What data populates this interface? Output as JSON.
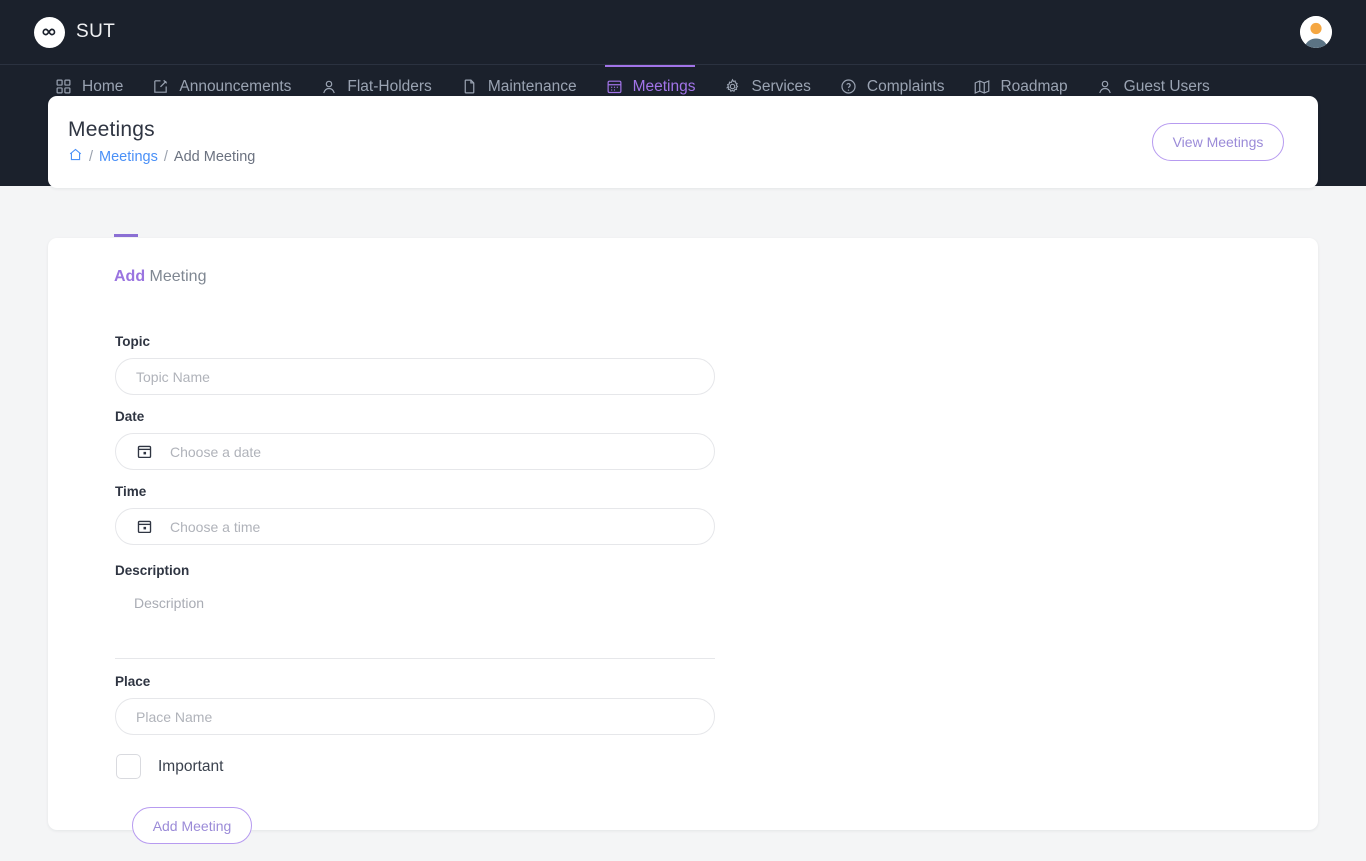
{
  "brand": {
    "logo_icon": "infinity-icon",
    "name": "SUT"
  },
  "account": {
    "avatar_icon": "user-avatar-icon"
  },
  "nav": {
    "items": [
      {
        "label": "Home",
        "icon": "grid-icon",
        "active": false
      },
      {
        "label": "Announcements",
        "icon": "edit-square-icon",
        "active": false
      },
      {
        "label": "Flat-Holders",
        "icon": "users-icon",
        "active": false
      },
      {
        "label": "Maintenance",
        "icon": "document-icon",
        "active": false
      },
      {
        "label": "Meetings",
        "icon": "calendar-icon",
        "active": true
      },
      {
        "label": "Services",
        "icon": "gear-icon",
        "active": false
      },
      {
        "label": "Complaints",
        "icon": "help-circle-icon",
        "active": false
      },
      {
        "label": "Roadmap",
        "icon": "map-icon",
        "active": false
      },
      {
        "label": "Guest Users",
        "icon": "user-icon",
        "active": false
      }
    ]
  },
  "header": {
    "title": "Meetings",
    "breadcrumb": {
      "home_icon": "home-icon",
      "sep1": "/",
      "link": "Meetings",
      "sep2": "/",
      "current": "Add Meeting"
    },
    "view_button": "View Meetings"
  },
  "form": {
    "heading_accent": "Add",
    "heading_rest": " Meeting",
    "topic": {
      "label": "Topic",
      "placeholder": "Topic Name",
      "value": ""
    },
    "date": {
      "label": "Date",
      "placeholder": "Choose a date",
      "value": "",
      "icon": "calendar-icon"
    },
    "time": {
      "label": "Time",
      "placeholder": "Choose a time",
      "value": "",
      "icon": "calendar-icon"
    },
    "description": {
      "label": "Description",
      "placeholder": "Description",
      "value": ""
    },
    "place": {
      "label": "Place",
      "placeholder": "Place Name",
      "value": ""
    },
    "important": {
      "label": "Important",
      "checked": false
    },
    "submit_label": "Add Meeting"
  },
  "colors": {
    "nav_background": "#1b212c",
    "accent_purple": "#9a74e0",
    "breadcrumb_link": "#4a90f7",
    "page_background": "#f4f5f6",
    "card_background": "#ffffff"
  }
}
